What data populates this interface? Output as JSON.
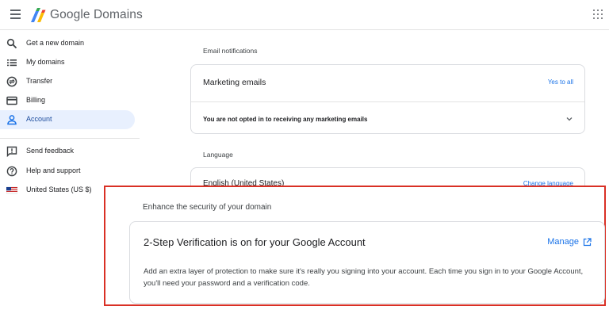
{
  "header": {
    "brand": "Google Domains",
    "menu_icon": "hamburger-menu-icon",
    "logo_icon": "google-domains-logo",
    "apps_icon": "apps-grid-icon"
  },
  "sidebar": {
    "items": [
      {
        "label": "Get a new domain",
        "icon": "search-icon"
      },
      {
        "label": "My domains",
        "icon": "list-icon"
      },
      {
        "label": "Transfer",
        "icon": "transfer-icon"
      },
      {
        "label": "Billing",
        "icon": "credit-card-icon"
      },
      {
        "label": "Account",
        "icon": "person-icon",
        "active": true
      }
    ],
    "secondary": [
      {
        "label": "Send feedback",
        "icon": "feedback-icon"
      },
      {
        "label": "Help and support",
        "icon": "help-icon"
      },
      {
        "label": "United States (US $)",
        "icon": "us-flag-icon"
      }
    ]
  },
  "main": {
    "email_notifications": {
      "heading": "Email notifications",
      "marketing_title": "Marketing emails",
      "yes_to_all": "Yes to all",
      "optin_status": "You are not opted in to receiving any marketing emails"
    },
    "language": {
      "heading": "Language",
      "value": "English (United States)",
      "change_label": "Change language"
    }
  },
  "security": {
    "heading": "Enhance the security of your domain",
    "card_title": "2-Step Verification is on for your Google Account",
    "manage_label": "Manage",
    "description": "Add an extra layer of protection to make sure it's really you signing into your account. Each time you sign in to your Google Account, you'll need your password and a verification code."
  },
  "colors": {
    "accent": "#1a73e8",
    "active_nav_bg": "#e8f0fe",
    "highlight_border": "#d93025"
  }
}
